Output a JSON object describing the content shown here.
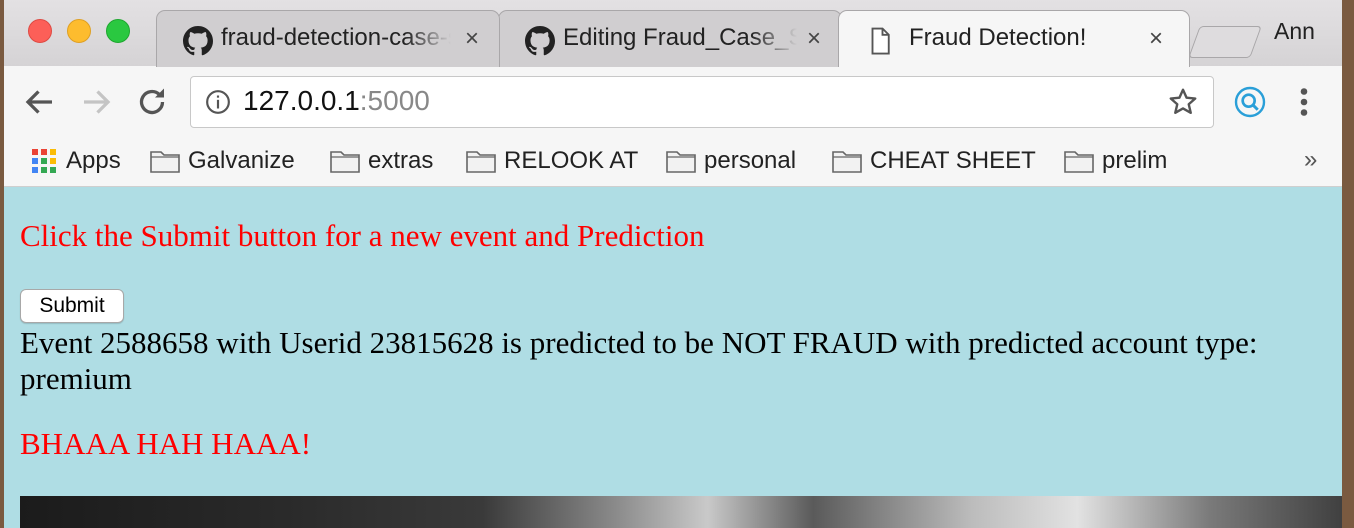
{
  "browser": {
    "tabs": [
      {
        "title": "fraud-detection-case-study",
        "icon": "github-icon",
        "active": false
      },
      {
        "title": "Editing Fraud_Case_Study",
        "icon": "github-icon",
        "active": false
      },
      {
        "title": "Fraud Detection!",
        "icon": "page-icon",
        "active": true
      }
    ],
    "close_glyph": "×",
    "profile": "Ann",
    "address": {
      "host": "127.0.0.1",
      "port": ":5000"
    },
    "bookmarks": [
      {
        "label": "Apps",
        "icon": "apps-grid-icon"
      },
      {
        "label": "Galvanize",
        "icon": "folder-icon"
      },
      {
        "label": "extras",
        "icon": "folder-icon"
      },
      {
        "label": "RELOOK AT",
        "icon": "folder-icon"
      },
      {
        "label": "personal",
        "icon": "folder-icon"
      },
      {
        "label": "CHEAT SHEET",
        "icon": "folder-icon"
      },
      {
        "label": "prelim",
        "icon": "folder-icon"
      }
    ],
    "bookmarks_overflow": "»"
  },
  "page": {
    "instruction": "Click the Submit button for a new event and Prediction",
    "submit_label": "Submit",
    "result": "Event 2588658 with Userid 23815628 is predicted to be NOT FRAUD with predicted account type: premium",
    "laugh": "BHAAA HAH HAAA!",
    "background_color": "#afdde4",
    "accent_color": "#ff0000"
  }
}
